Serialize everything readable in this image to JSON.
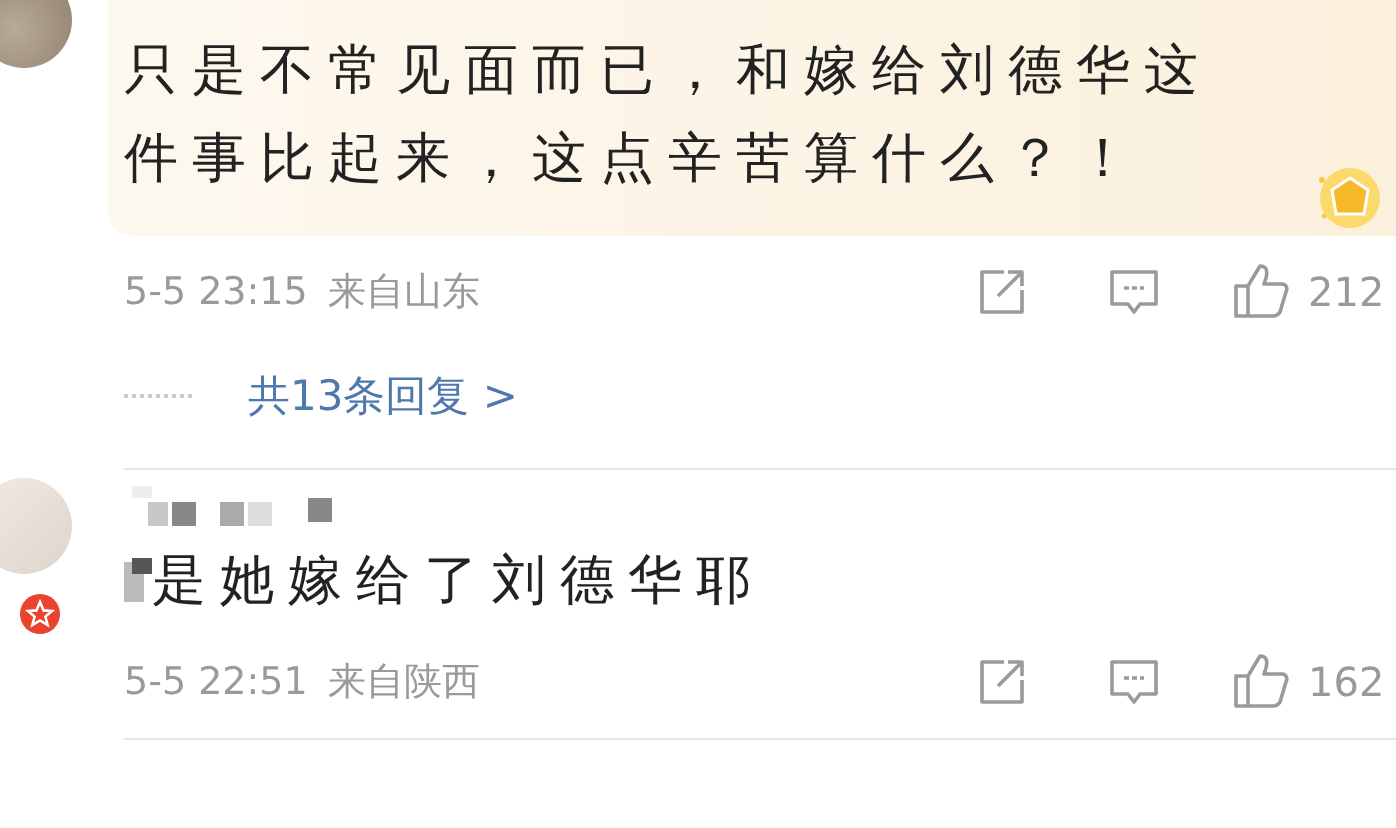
{
  "comments": [
    {
      "highlighted": true,
      "verified": false,
      "name_hidden": false,
      "text": "只是不常见面而已，和嫁给刘德华这件事比起来，这点辛苦算什么？！",
      "date": "5-5 23:15",
      "location": "来自山东",
      "likes": "212",
      "replies": "共13条回复 >"
    },
    {
      "highlighted": false,
      "verified": true,
      "name_hidden": true,
      "text": "是她嫁给了刘德华耶",
      "date": "5-5 22:51",
      "location": "来自陕西",
      "likes": "162"
    }
  ]
}
